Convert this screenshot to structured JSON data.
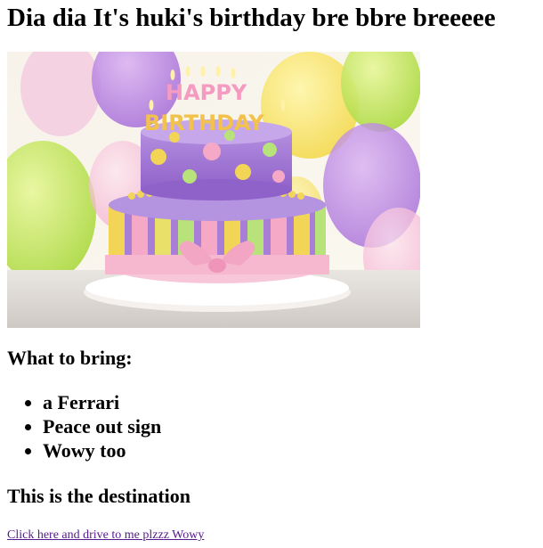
{
  "page": {
    "title": "Dia dia It's huki's birthday bre bbre breeeee"
  },
  "image": {
    "alt": "birthday-cake-image",
    "cake_text_top": "HAPPY",
    "cake_text_bottom": "BIRTHDAY"
  },
  "bring": {
    "heading": "What to bring:",
    "items": [
      "a Ferrari",
      "Peace out sign",
      "Wowy too"
    ]
  },
  "destination": {
    "heading": "This is the destination",
    "link_text": "Click here and drive to me plzzz Wowy"
  }
}
